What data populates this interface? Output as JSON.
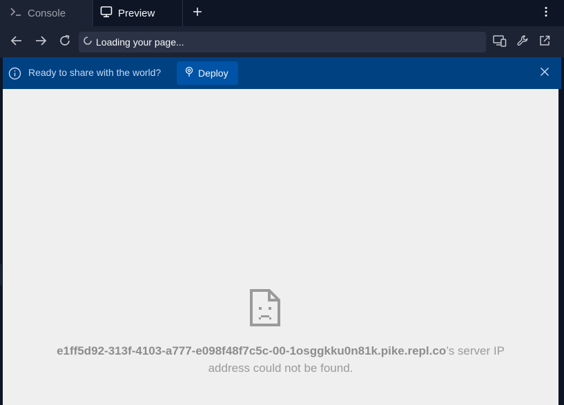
{
  "tabs": [
    {
      "label": "Console",
      "icon": "terminal-icon",
      "active": false
    },
    {
      "label": "Preview",
      "icon": "monitor-icon",
      "active": true
    }
  ],
  "urlbar": {
    "address": "Loading your page...",
    "status_icon": "loading-spinner-icon"
  },
  "banner": {
    "message": "Ready to share with the world?",
    "deploy_label": "Deploy"
  },
  "error": {
    "host": "e1ff5d92-313f-4103-a777-e098f48f7c5c-00-1osggkku0n81k.pike.repl.co",
    "line1_suffix": "’s server IP",
    "line2": "address could not be found."
  },
  "colors": {
    "background": "#0e1525",
    "toolbar": "#1c2333",
    "banner": "#004182",
    "deploy_button": "#0053a6",
    "viewport": "#efefef"
  }
}
